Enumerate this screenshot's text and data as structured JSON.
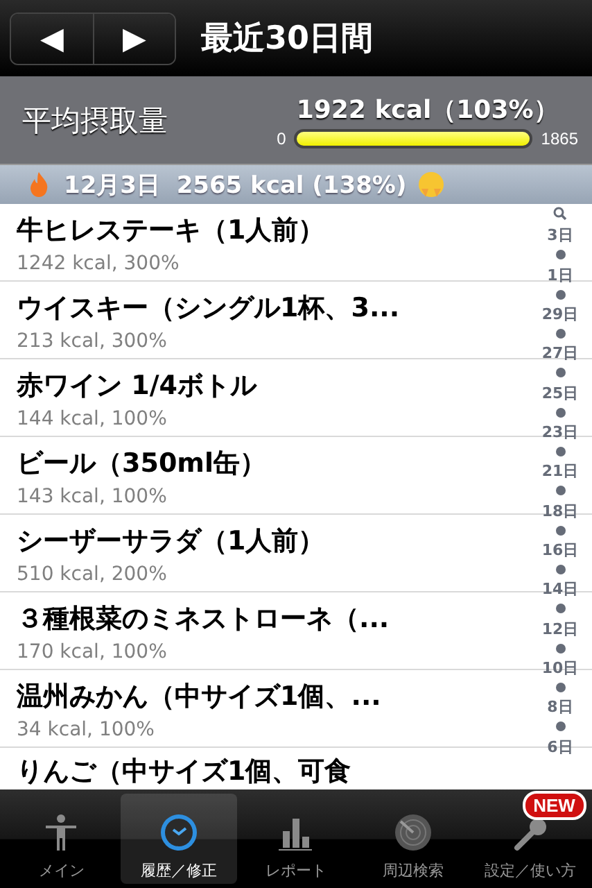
{
  "nav": {
    "prev": "◀",
    "next": "▶",
    "title": "最近30日間"
  },
  "summary": {
    "label": "平均摂取量",
    "value": "1922 kcal（103%）",
    "min": "0",
    "max": "1865",
    "level": 1.0
  },
  "section": {
    "title": "12月3日  2565 kcal (138%)"
  },
  "items": [
    {
      "name": "牛ヒレステーキ（1人前）",
      "detail": "1242 kcal, 300%"
    },
    {
      "name": "ウイスキー（シングル1杯、3...",
      "detail": "213 kcal, 300%"
    },
    {
      "name": "赤ワイン 1/4ボトル",
      "detail": "144 kcal, 100%"
    },
    {
      "name": "ビール（350ml缶）",
      "detail": "143 kcal, 100%"
    },
    {
      "name": "シーザーサラダ（1人前）",
      "detail": "510 kcal, 200%"
    },
    {
      "name": "３種根菜のミネストローネ（...",
      "detail": "170 kcal, 100%"
    },
    {
      "name": "温州みかん（中サイズ1個、...",
      "detail": "34 kcal, 100%"
    },
    {
      "name": "りんご（中サイズ1個、可食"
    }
  ],
  "index": [
    "3日",
    "1日",
    "29日",
    "27日",
    "25日",
    "23日",
    "21日",
    "18日",
    "16日",
    "14日",
    "12日",
    "10日",
    "8日",
    "6日"
  ],
  "tabs": [
    {
      "label": "メイン",
      "kind": "person",
      "selected": false
    },
    {
      "label": "履歴／修正",
      "kind": "clock",
      "selected": true
    },
    {
      "label": "レポート",
      "kind": "chart",
      "selected": false
    },
    {
      "label": "周辺検索",
      "kind": "radar",
      "selected": false
    },
    {
      "label": "設定／使い方",
      "kind": "wrench",
      "selected": false,
      "badge": "NEW"
    }
  ]
}
